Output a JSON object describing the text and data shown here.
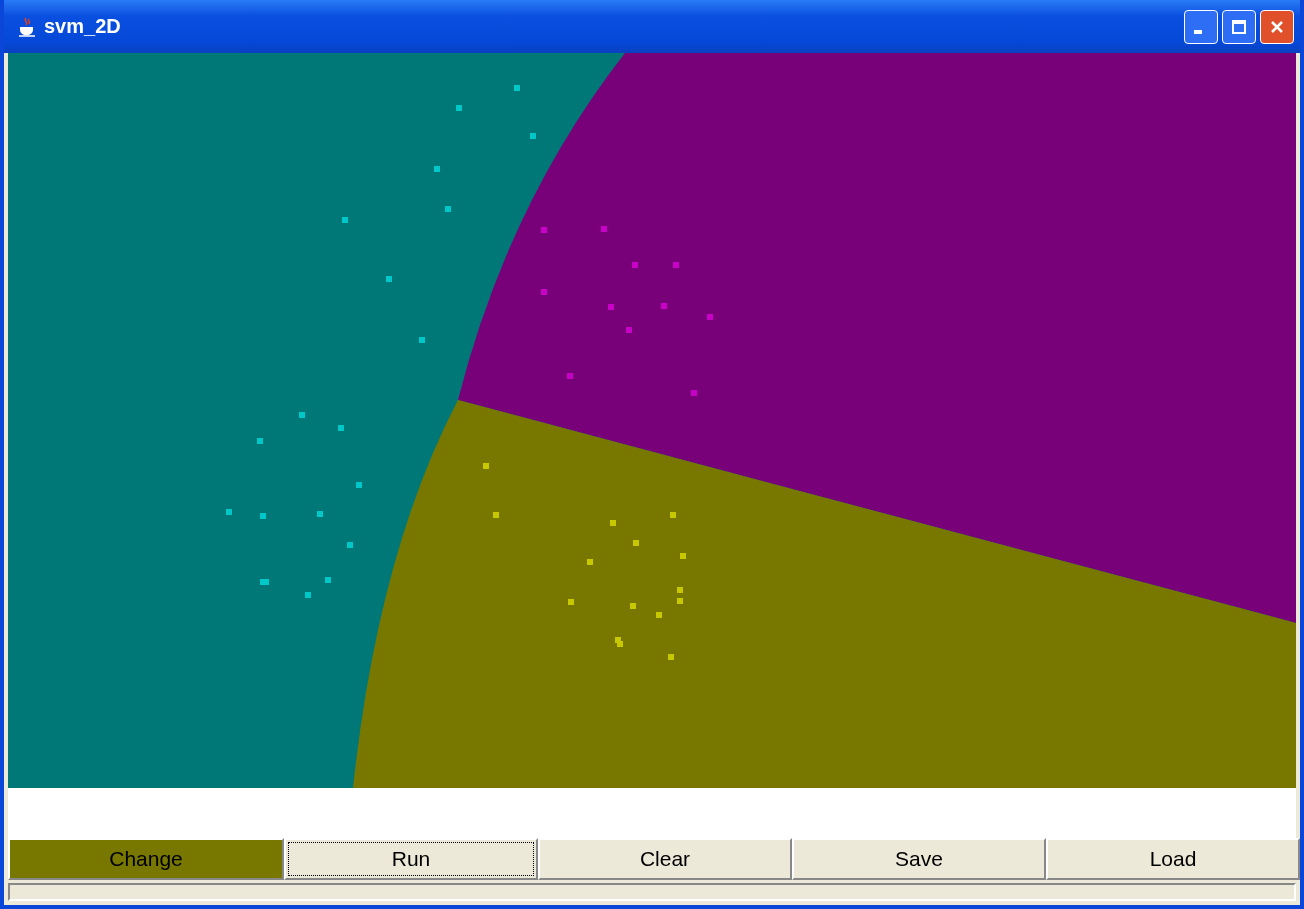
{
  "window": {
    "title": "svm_2D"
  },
  "buttons": [
    {
      "label": "Change",
      "focused": false,
      "color": "#787800"
    },
    {
      "label": "Run",
      "focused": true
    },
    {
      "label": "Clear",
      "focused": false
    },
    {
      "label": "Save",
      "focused": false
    },
    {
      "label": "Load",
      "focused": false
    }
  ]
}
